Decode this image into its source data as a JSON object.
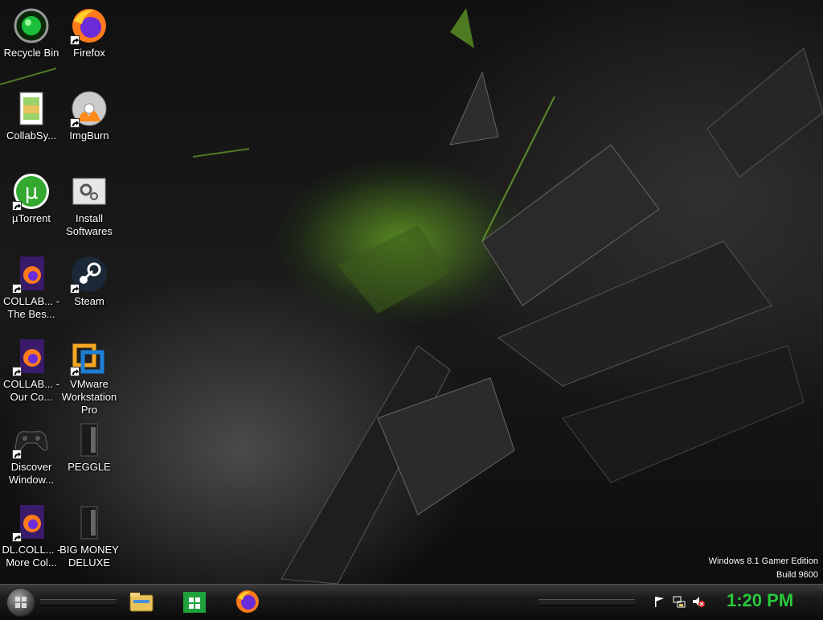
{
  "desktop": {
    "icons": [
      {
        "label": "Recycle Bin",
        "icon": "recycle-bin-icon",
        "shortcut": false
      },
      {
        "label": "Firefox",
        "icon": "firefox-icon",
        "shortcut": true
      },
      {
        "label": "CollabSy...",
        "icon": "folder-icon",
        "shortcut": false
      },
      {
        "label": "ImgBurn",
        "icon": "imgburn-icon",
        "shortcut": true
      },
      {
        "label": "µTorrent",
        "icon": "utorrent-icon",
        "shortcut": true
      },
      {
        "label": "Install Softwares",
        "icon": "gears-icon",
        "shortcut": false
      },
      {
        "label": "COLLAB... - The Bes...",
        "icon": "firefox-document-icon",
        "shortcut": true
      },
      {
        "label": "Steam",
        "icon": "steam-icon",
        "shortcut": true
      },
      {
        "label": "COLLAB... - Our Co...",
        "icon": "firefox-document-icon",
        "shortcut": true
      },
      {
        "label": "VMware Workstation Pro",
        "icon": "vmware-icon",
        "shortcut": true
      },
      {
        "label": "Discover Window...",
        "icon": "gamepad-icon",
        "shortcut": true
      },
      {
        "label": "PEGGLE",
        "icon": "file-icon",
        "shortcut": false
      },
      {
        "label": "DL.COLL... - More Col...",
        "icon": "firefox-document-icon",
        "shortcut": true
      },
      {
        "label": "BIG MONEY DELUXE",
        "icon": "file-icon",
        "shortcut": false
      }
    ]
  },
  "watermark": {
    "line1": "Windows 8.1 Gamer Edition",
    "line2": "Build 9600"
  },
  "taskbar": {
    "start_icon": "start-orb-icon",
    "pinned": [
      {
        "icon": "file-explorer-icon"
      },
      {
        "icon": "store-icon"
      },
      {
        "icon": "firefox-icon"
      }
    ],
    "tray": [
      {
        "icon": "flag-icon"
      },
      {
        "icon": "network-icon"
      },
      {
        "icon": "speaker-muted-icon"
      }
    ],
    "clock": "1:20 PM"
  },
  "colors": {
    "accent_green": "#28c93a",
    "wallpaper_glow": "#8ce628"
  }
}
